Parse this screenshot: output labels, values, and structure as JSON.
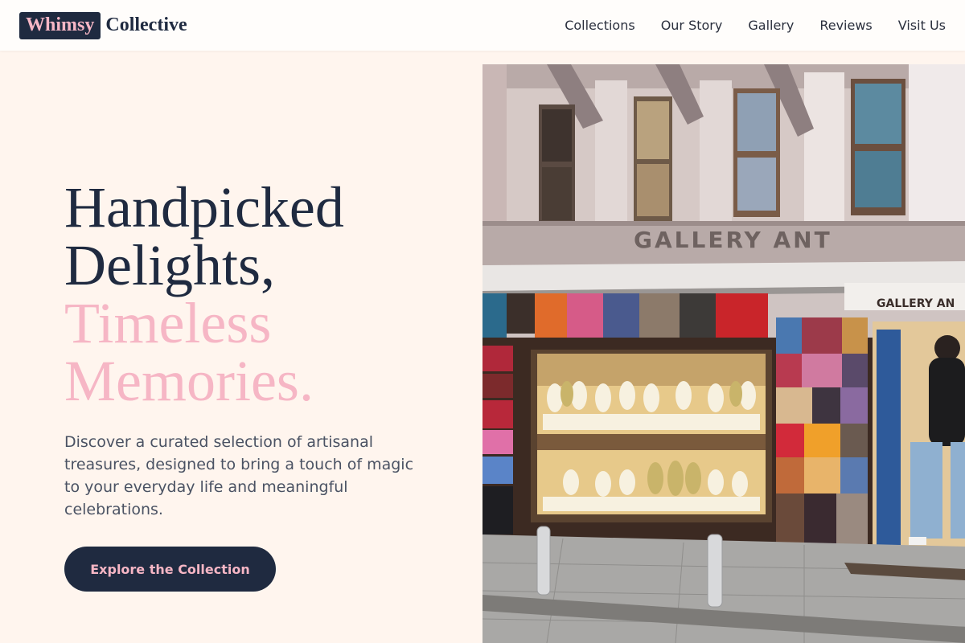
{
  "brand": {
    "highlight": "Whimsy",
    "rest": "Collective"
  },
  "nav": {
    "items": [
      "Collections",
      "Our Story",
      "Gallery",
      "Reviews",
      "Visit Us"
    ]
  },
  "hero": {
    "line1": "Handpicked",
    "line2": "Delights,",
    "line3": "Timeless",
    "line4": "Memories.",
    "description": "Discover a curated selection of artisanal treasures, designed to bring a touch of magic to your everyday life and meaningful celebrations.",
    "cta_label": "Explore the Collection"
  },
  "photo": {
    "sign_text": "GALLERY ANT",
    "side_sign_text": "GALLERY AN"
  },
  "colors": {
    "navy": "#1f2a40",
    "pink": "#f6b6c5",
    "cream": "#fff5ee"
  }
}
